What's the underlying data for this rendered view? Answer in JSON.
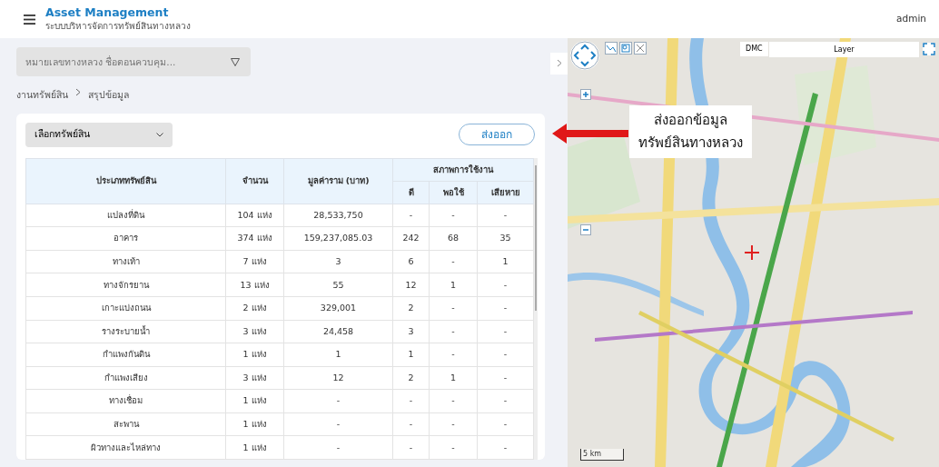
{
  "header": {
    "title": "Asset Management",
    "subtitle": "ระบบบริหารจัดการทรัพย์สินทางหลวง",
    "user": "admin"
  },
  "search": {
    "placeholder": "หมายเลขทางหลวง ชื่อตอนควบคุม..."
  },
  "breadcrumb": [
    "งานทรัพย์สิน",
    "สรุปข้อมูล"
  ],
  "asset_select": {
    "value": "เลือกทรัพย์สิน"
  },
  "export_button": "ส่งออก",
  "table": {
    "columns": [
      "ประเภททรัพย์สิน",
      "จำนวน",
      "มูลค่าราม (บาท)"
    ],
    "group": "สภาพการใช้งาน",
    "subcolumns": [
      "ดี",
      "พอใช้",
      "เสียหาย"
    ],
    "rows": [
      {
        "cells": [
          "แปลงที่ดิน",
          "104 แห่ง",
          "28,533,750",
          "-",
          "-",
          "-"
        ]
      },
      {
        "cells": [
          "อาคาร",
          "374 แห่ง",
          "159,237,085.03",
          "242",
          "68",
          "35"
        ]
      },
      {
        "cells": [
          "ทางเท้า",
          "7 แห่ง",
          "3",
          "6",
          "-",
          "1"
        ]
      },
      {
        "cells": [
          "ทางจักรยาน",
          "13 แห่ง",
          "55",
          "12",
          "1",
          "-"
        ]
      },
      {
        "cells": [
          "เกาะแบ่งถนน",
          "2 แห่ง",
          "329,001",
          "2",
          "-",
          "-"
        ]
      },
      {
        "cells": [
          "รางระบายน้ำ",
          "3 แห่ง",
          "24,458",
          "3",
          "-",
          "-"
        ]
      },
      {
        "cells": [
          "กำแพงกันดิน",
          "1 แห่ง",
          "1",
          "1",
          "-",
          "-"
        ]
      },
      {
        "cells": [
          "กำแพงเสียง",
          "3 แห่ง",
          "12",
          "2",
          "1",
          "-"
        ]
      },
      {
        "cells": [
          "ทางเชื่อม",
          "1 แห่ง",
          "-",
          "-",
          "-",
          "-"
        ]
      },
      {
        "cells": [
          "สะพาน",
          "1 แห่ง",
          "-",
          "-",
          "-",
          "-"
        ]
      },
      {
        "cells": [
          "ผิวทางและไหล่ทาง",
          "1 แห่ง",
          "-",
          "-",
          "-",
          "-"
        ]
      }
    ]
  },
  "map": {
    "kind": "picture",
    "basemap_button": "DMC",
    "layer_select": "Layer",
    "scale": "5 km"
  },
  "callout": {
    "lines": [
      "ส่งออกข้อมูล",
      "ทรัพย์สินทางหลวง"
    ]
  }
}
